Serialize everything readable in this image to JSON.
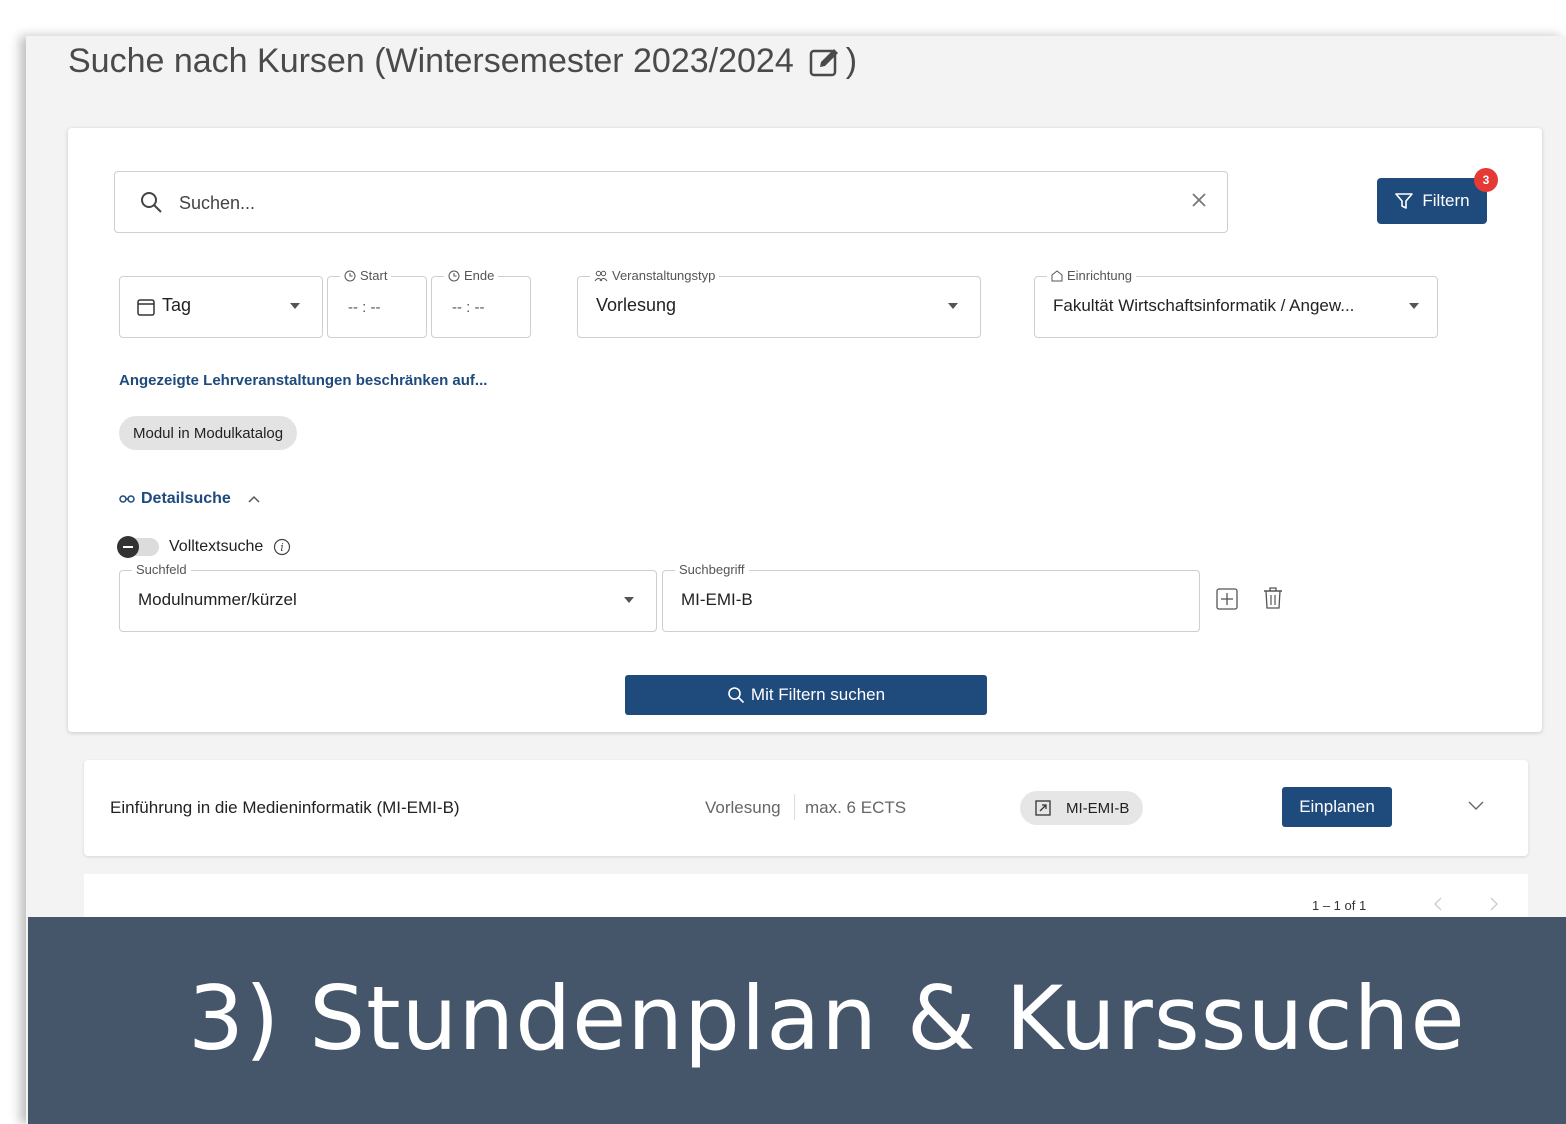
{
  "page": {
    "title": "Suche nach Kursen (Wintersemester 2023/2024",
    "title_suffix": ")"
  },
  "search": {
    "placeholder": "Suchen...",
    "value": ""
  },
  "filter_button": {
    "label": "Filtern",
    "badge_count": "3"
  },
  "filters": {
    "day": {
      "value": "Tag"
    },
    "start": {
      "label": "Start",
      "value": "-- : --"
    },
    "end": {
      "label": "Ende",
      "value": "-- : --"
    },
    "event_type": {
      "label": "Veranstaltungstyp",
      "value": "Vorlesung"
    },
    "institution": {
      "label": "Einrichtung",
      "value": "Fakultät Wirtschaftsinformatik / Angew..."
    }
  },
  "restrict": {
    "link": "Angezeigte Lehrveranstaltungen beschränken auf...",
    "chip": "Modul in Modulkatalog"
  },
  "detail_search": {
    "label": "Detailsuche",
    "fulltext_label": "Volltextsuche",
    "fulltext_enabled": false,
    "field": {
      "label": "Suchfeld",
      "value": "Modulnummer/kürzel"
    },
    "term": {
      "label": "Suchbegriff",
      "value": "MI-EMI-B"
    }
  },
  "search_button": {
    "label": "Mit Filtern suchen"
  },
  "results": [
    {
      "title": "Einführung in die Medieninformatik (MI-EMI-B)",
      "type": "Vorlesung",
      "ects": "max. 6 ECTS",
      "module": "MI-EMI-B",
      "action": "Einplanen"
    }
  ],
  "pagination": {
    "range": "1 – 1 of 1"
  },
  "banner": {
    "text": "3) Stundenplan & Kurssuche"
  },
  "colors": {
    "primary": "#1f4a7c",
    "badge": "#e53935",
    "banner_bg": "#45566b",
    "page_bg": "#f3f3f3"
  }
}
